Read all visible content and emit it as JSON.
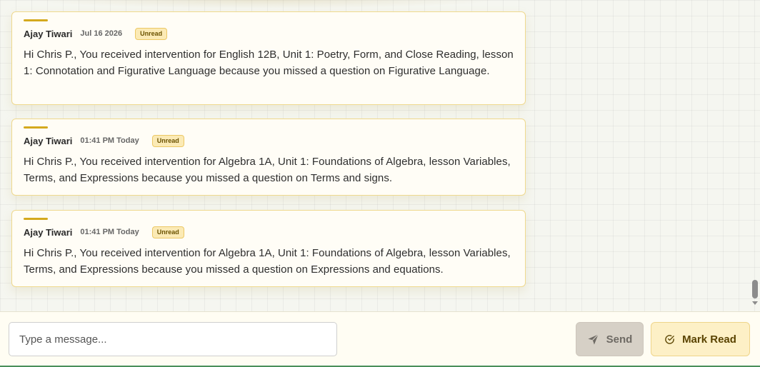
{
  "messages": [
    {
      "author": "Ajay Tiwari",
      "time": "Jul 16 2026",
      "badge": "Unread",
      "body": "Hi Chris P., You received intervention for English 12B, Unit 1: Poetry, Form, and Close Reading, lesson 1: Connotation and Figurative Language because you missed a question on Figurative Language."
    },
    {
      "author": "Ajay Tiwari",
      "time": "01:41 PM Today",
      "badge": "Unread",
      "body": "Hi Chris P., You received intervention for Algebra 1A, Unit 1: Foundations of Algebra, lesson Variables, Terms, and Expressions because you missed a question on Terms and signs."
    },
    {
      "author": "Ajay Tiwari",
      "time": "01:41 PM Today",
      "badge": "Unread",
      "body": "Hi Chris P., You received intervention for Algebra 1A, Unit 1: Foundations of Algebra, lesson Variables, Terms, and Expressions because you missed a question on Expressions and equations."
    }
  ],
  "composer": {
    "placeholder": "Type a message...",
    "value": "",
    "send_label": "Send",
    "send_icon": "send-icon",
    "mark_read_label": "Mark Read",
    "mark_read_icon": "check-circle-icon"
  },
  "colors": {
    "accent": "#d4a91e",
    "card_border": "#efd98e",
    "badge_bg": "#fbeab5",
    "send_bg": "#d6d0c6",
    "mark_read_bg": "#fdf0c6"
  }
}
